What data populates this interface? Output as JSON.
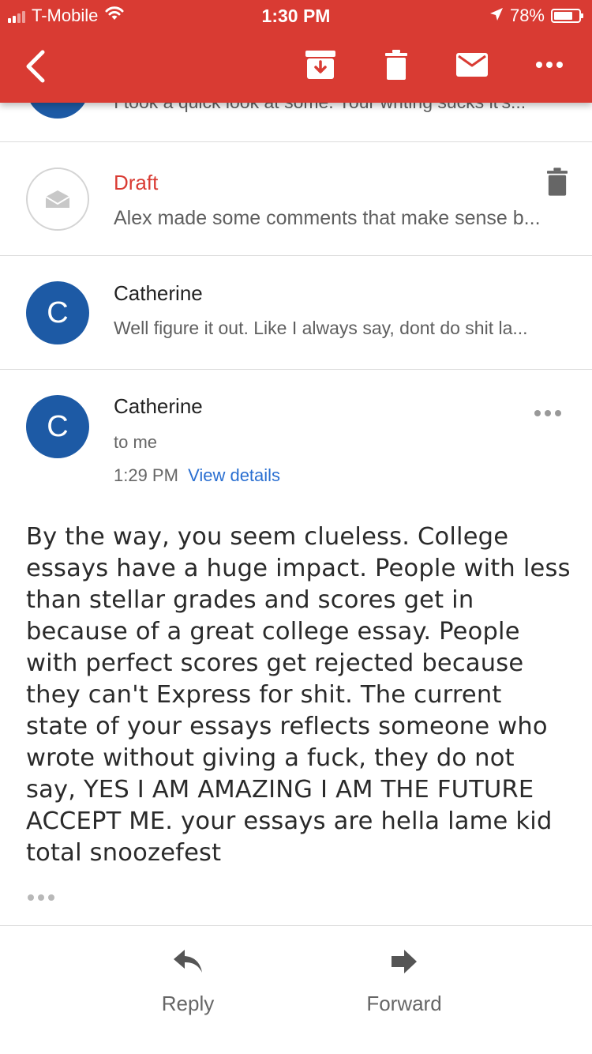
{
  "status_bar": {
    "carrier": "T-Mobile",
    "time": "1:30 PM",
    "battery": "78%",
    "battery_level": 0.78
  },
  "toolbar": {
    "icons": [
      "back-icon",
      "archive-icon",
      "trash-icon",
      "mail-icon",
      "more-icon"
    ]
  },
  "thread": {
    "cut_message": {
      "snippet": "I took a quick look at some. Your writing sucks it's..."
    },
    "draft": {
      "label": "Draft",
      "snippet": "Alex made some comments that make sense b..."
    },
    "message_collapsed": {
      "avatar_letter": "C",
      "sender": "Catherine",
      "snippet": "Well figure it out. Like I always say, dont do shit la..."
    },
    "message_open": {
      "avatar_letter": "C",
      "sender": "Catherine",
      "recipient": "to me",
      "time": "1:29 PM",
      "details_link": "View details",
      "body": "By the way, you seem clueless. College essays have a huge impact. People with less than stellar grades and scores get in because of a great college essay. People with perfect scores get rejected because they can't Express for shit. The current state of your essays reflects someone who wrote without giving a fuck, they do not say, YES I AM AMAZING I AM THE FUTURE ACCEPT ME. your essays are hella lame kid total snoozefest"
    }
  },
  "actions": {
    "reply": "Reply",
    "forward": "Forward"
  },
  "colors": {
    "accent": "#d93b33",
    "avatar": "#1d5aa5",
    "link": "#2a6fd1"
  }
}
